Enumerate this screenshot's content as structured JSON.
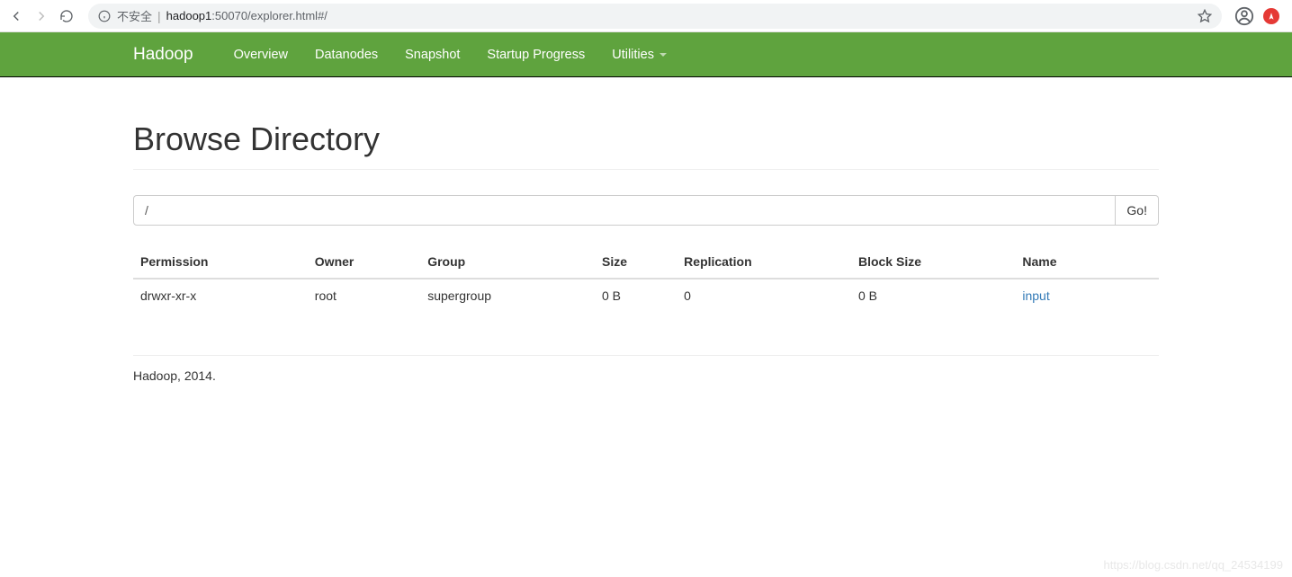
{
  "browser": {
    "security_label": "不安全",
    "url_host": "hadoop1",
    "url_rest": ":50070/explorer.html#/"
  },
  "navbar": {
    "brand": "Hadoop",
    "items": [
      "Overview",
      "Datanodes",
      "Snapshot",
      "Startup Progress",
      "Utilities"
    ]
  },
  "page": {
    "title": "Browse Directory",
    "path_value": "/",
    "go_label": "Go!"
  },
  "table": {
    "headers": {
      "permission": "Permission",
      "owner": "Owner",
      "group": "Group",
      "size": "Size",
      "replication": "Replication",
      "block_size": "Block Size",
      "name": "Name"
    },
    "rows": [
      {
        "permission": "drwxr-xr-x",
        "owner": "root",
        "group": "supergroup",
        "size": "0 B",
        "replication": "0",
        "block_size": "0 B",
        "name": "input"
      }
    ]
  },
  "footer": "Hadoop, 2014.",
  "watermark": "https://blog.csdn.net/qq_24534199"
}
